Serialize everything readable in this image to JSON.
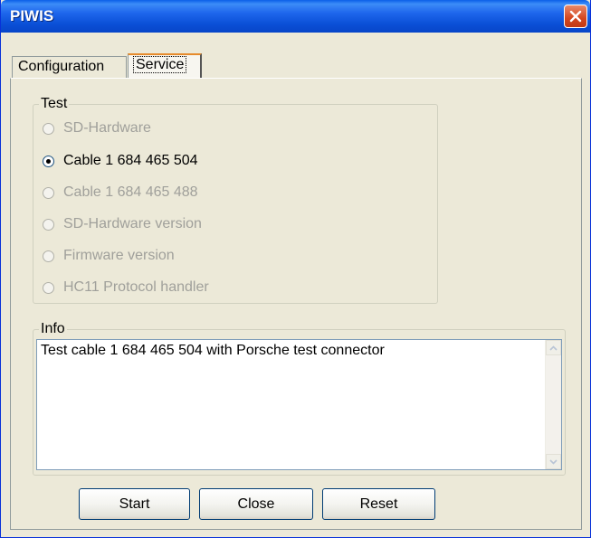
{
  "window": {
    "title": "PIWIS",
    "close_icon": "close-icon"
  },
  "tabs": [
    {
      "label": "Configuration",
      "selected": false
    },
    {
      "label": "Service",
      "selected": true
    }
  ],
  "test_group": {
    "legend": "Test",
    "options": [
      {
        "label": "SD-Hardware",
        "selected": false,
        "enabled": false
      },
      {
        "label": "Cable 1 684 465 504",
        "selected": true,
        "enabled": true
      },
      {
        "label": "Cable 1 684 465 488",
        "selected": false,
        "enabled": false
      },
      {
        "label": "SD-Hardware version",
        "selected": false,
        "enabled": false
      },
      {
        "label": "Firmware version",
        "selected": false,
        "enabled": false
      },
      {
        "label": "HC11 Protocol handler",
        "selected": false,
        "enabled": false
      }
    ]
  },
  "info_group": {
    "legend": "Info",
    "text": "Test cable 1 684 465 504 with Porsche test connector"
  },
  "buttons": {
    "start": "Start",
    "close": "Close",
    "reset": "Reset"
  },
  "colors": {
    "titlebar": "#0a4fd6",
    "face": "#ece9d8",
    "tab_highlight": "#e68b2c",
    "close_button": "#d4461e"
  }
}
